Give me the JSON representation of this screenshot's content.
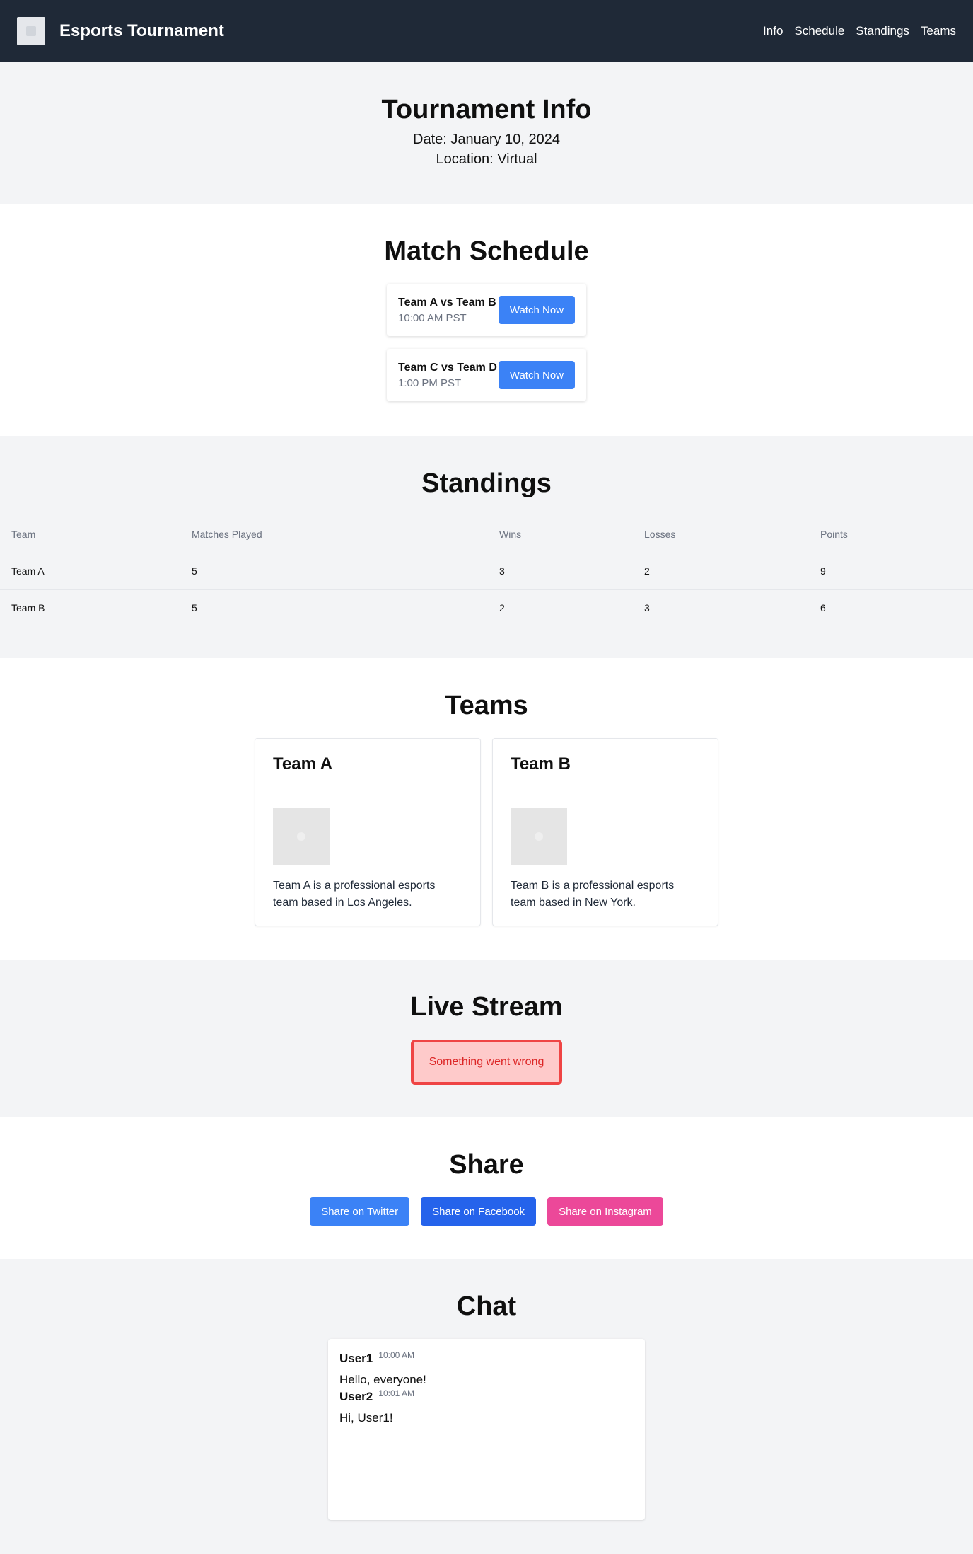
{
  "header": {
    "title": "Esports Tournament",
    "nav": [
      "Info",
      "Schedule",
      "Standings",
      "Teams"
    ]
  },
  "info": {
    "title": "Tournament Info",
    "date": "Date: January 10, 2024",
    "location": "Location: Virtual"
  },
  "schedule": {
    "title": "Match Schedule",
    "matches": [
      {
        "title": "Team A vs Team B",
        "time": "10:00 AM PST",
        "button": "Watch Now"
      },
      {
        "title": "Team C vs Team D",
        "time": "1:00 PM PST",
        "button": "Watch Now"
      }
    ]
  },
  "standings": {
    "title": "Standings",
    "headers": [
      "Team",
      "Matches Played",
      "Wins",
      "Losses",
      "Points"
    ],
    "rows": [
      [
        "Team A",
        "5",
        "3",
        "2",
        "9"
      ],
      [
        "Team B",
        "5",
        "2",
        "3",
        "6"
      ]
    ]
  },
  "teams": {
    "title": "Teams",
    "cards": [
      {
        "name": "Team A",
        "description": "Team A is a professional esports team based in Los Angeles."
      },
      {
        "name": "Team B",
        "description": "Team B is a professional esports team based in New York."
      }
    ]
  },
  "live": {
    "title": "Live Stream",
    "error": "Something went wrong"
  },
  "share": {
    "title": "Share",
    "twitter": "Share on Twitter",
    "facebook": "Share on Facebook",
    "instagram": "Share on Instagram"
  },
  "chat": {
    "title": "Chat",
    "messages": [
      {
        "user": "User1",
        "time": "10:00 AM",
        "text": "Hello, everyone!"
      },
      {
        "user": "User2",
        "time": "10:01 AM",
        "text": "Hi, User1!"
      }
    ]
  },
  "colors": {
    "header_bg": "#1f2937",
    "primary": "#3b82f6",
    "facebook": "#2563eb",
    "instagram": "#ec4899",
    "error": "#ef4444"
  }
}
